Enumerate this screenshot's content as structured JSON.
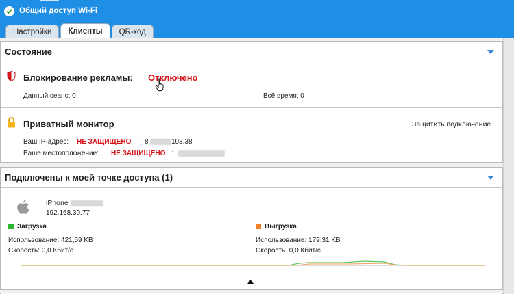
{
  "header": {
    "status_text": "Общий доступ Wi-Fi",
    "tabs": [
      {
        "label": "Настройки"
      },
      {
        "label": "Клиенты"
      },
      {
        "label": "QR-код"
      }
    ]
  },
  "status_panel": {
    "title": "Состояние",
    "adblock": {
      "title": "Блокирование рекламы:",
      "state": "Отключено",
      "session_label": "Данный сеанс: 0",
      "total_label": "Всё время: 0"
    },
    "private_monitor": {
      "title": "Приватный монитор",
      "protect_link": "Защитить подключение",
      "ip_label": "Ваш IP-адрес:",
      "ip_state": "НЕ ЗАЩИЩЕНО",
      "ip_sep": ":",
      "ip_prefix": "8",
      "ip_suffix": "103.38",
      "location_label": "Ваше местоположение:",
      "location_state": "НЕ ЗАЩИЩЕНО",
      "location_sep": ":"
    }
  },
  "clients_panel": {
    "title": "Подключены к моей точке доступа (1)",
    "device": {
      "name_prefix": "iPhone",
      "ip": "192.168.30.77"
    },
    "download": {
      "label": "Загрузка",
      "color": "#2db52d",
      "usage": "Использование: 421,59 KB",
      "speed": "Скорость: 0,0 Кбит/с"
    },
    "upload": {
      "label": "Выгрузка",
      "color": "#f07f2a",
      "usage": "Использование: 179,31 KB",
      "speed": "Скорость: 0,0 Кбит/с"
    }
  },
  "colors": {
    "header_blue": "#1f8fe6",
    "warning_red": "#d4141a",
    "accent_blue": "#3a8ad6"
  }
}
